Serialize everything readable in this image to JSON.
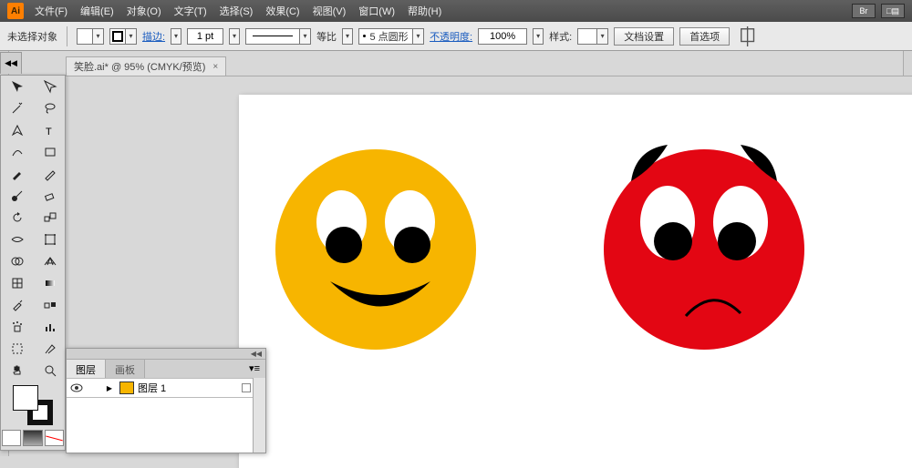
{
  "app_logo": "Ai",
  "menubar": [
    "文件(F)",
    "编辑(E)",
    "对象(O)",
    "文字(T)",
    "选择(S)",
    "效果(C)",
    "视图(V)",
    "窗口(W)",
    "帮助(H)"
  ],
  "menubar_right": [
    "Br",
    "□▤"
  ],
  "options": {
    "no_selection": "未选择对象",
    "stroke_label": "描边:",
    "stroke_pt": "1 pt",
    "ratio_label": "等比",
    "dot_label": "5 点圆形",
    "opacity_label": "不透明度:",
    "opacity_value": "100%",
    "style_label": "样式:",
    "doc_setup": "文档设置",
    "prefs": "首选项"
  },
  "doc_tab": {
    "title": "笑脸.ai* @ 95% (CMYK/预览)",
    "close": "×"
  },
  "toolbox_tab": "◀◀",
  "layers": {
    "tab1": "图层",
    "tab2": "画板",
    "layer1_name": "图层 1",
    "menu": "▾≡",
    "drag": "◀◀"
  },
  "illustration": {
    "happy_color": "#f7b500",
    "angry_color": "#e30613"
  }
}
